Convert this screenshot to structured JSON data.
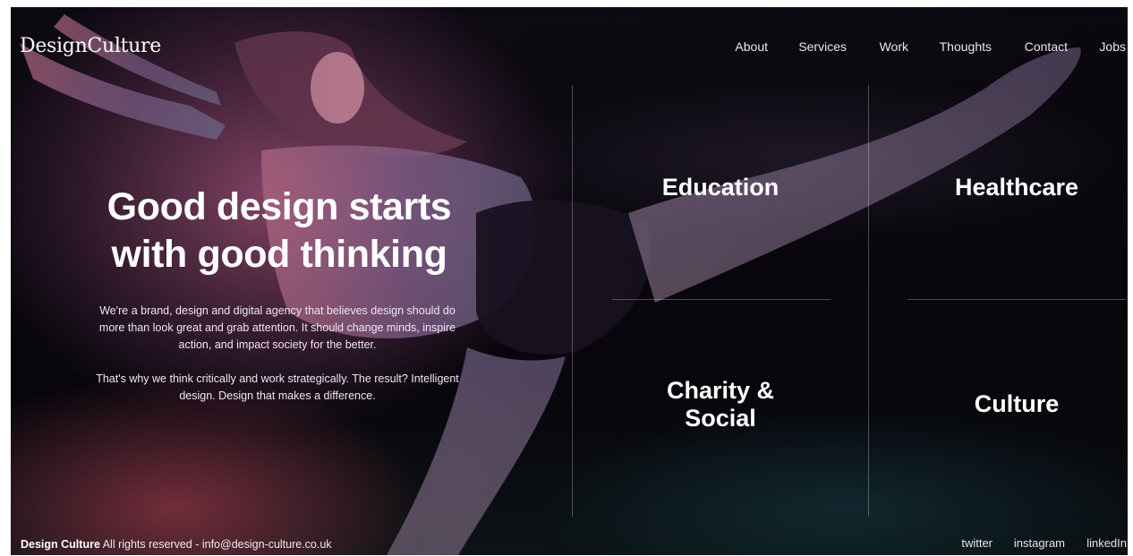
{
  "brand": {
    "logo_text": "DesignCulture"
  },
  "nav": {
    "items": [
      {
        "label": "About"
      },
      {
        "label": "Services"
      },
      {
        "label": "Work"
      },
      {
        "label": "Thoughts"
      },
      {
        "label": "Contact"
      },
      {
        "label": "Jobs"
      }
    ]
  },
  "hero": {
    "title_line1": "Good design starts",
    "title_line2": "with good thinking",
    "paragraph1": "We're a brand, design and digital agency that believes design should do more than look great and grab attention. It should change minds, inspire action, and impact society for the better.",
    "paragraph2": "That's why we think critically and work strategically. The result? Intelligent design. Design that makes a difference."
  },
  "sectors": {
    "education": "Education",
    "healthcare": "Healthcare",
    "charity_line1": "Charity &",
    "charity_line2": "Social",
    "culture": "Culture"
  },
  "footer": {
    "company": "Design Culture",
    "rights": "All rights reserved - info@design-culture.co.uk",
    "social": [
      {
        "label": "twitter"
      },
      {
        "label": "instagram"
      },
      {
        "label": "linkedIn"
      }
    ]
  },
  "colors": {
    "background": "#0b0710",
    "text": "#ffffff",
    "hero_tint": "#aa5882",
    "floor_teal": "#1e5a64"
  }
}
